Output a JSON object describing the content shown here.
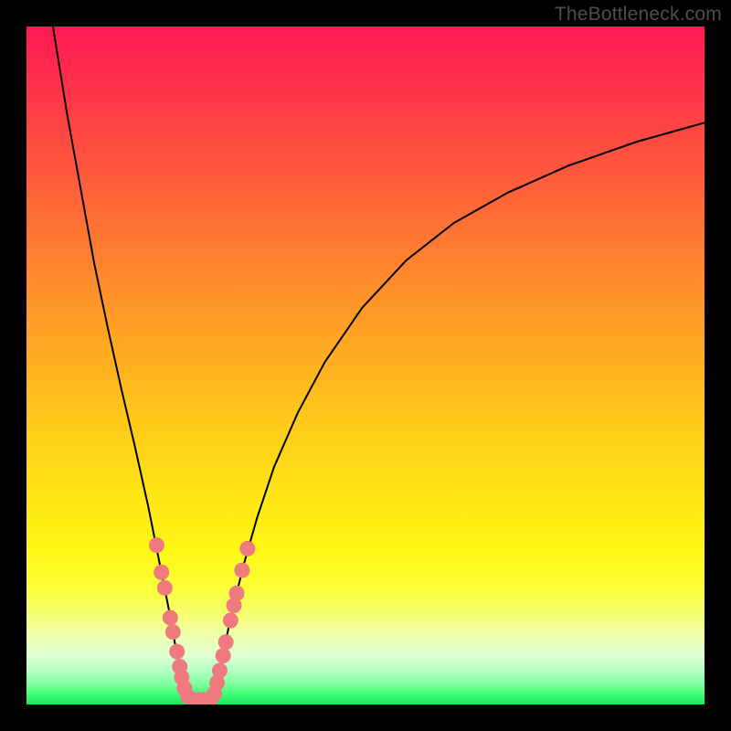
{
  "watermark": "TheBottleneck.com",
  "colors": {
    "frame": "#000000",
    "curve": "#000000",
    "marker_fill": "#ee7a80",
    "marker_stroke": "#c9595f"
  },
  "chart_data": {
    "type": "line",
    "title": "",
    "xlabel": "",
    "ylabel": "",
    "xlim": [
      0,
      100
    ],
    "ylim": [
      0,
      100
    ],
    "grid": false,
    "legend": false,
    "series": [
      {
        "name": "left-curve",
        "x": [
          3.9,
          6.0,
          8.0,
          10.0,
          12.0,
          14.0,
          16.0,
          18.0,
          19.0,
          20.0,
          21.0,
          21.9,
          22.7,
          23.4,
          24.0
        ],
        "y": [
          100.0,
          87.0,
          76.0,
          65.0,
          55.5,
          46.5,
          38.0,
          29.0,
          24.0,
          19.0,
          14.0,
          9.0,
          4.5,
          1.8,
          0.0
        ]
      },
      {
        "name": "right-curve",
        "x": [
          27.5,
          28.3,
          29.3,
          30.4,
          32.0,
          34.0,
          36.5,
          40.0,
          44.0,
          49.5,
          56.0,
          63.0,
          71.0,
          80.0,
          90.0,
          100.0
        ],
        "y": [
          0.0,
          4.0,
          9.0,
          14.0,
          20.5,
          27.5,
          35.0,
          43.0,
          50.5,
          58.5,
          65.5,
          71.0,
          75.5,
          79.5,
          83.0,
          85.8
        ]
      }
    ],
    "markers": {
      "name": "highlighted-points",
      "points": [
        {
          "x": 19.2,
          "y": 23.5
        },
        {
          "x": 19.9,
          "y": 19.5
        },
        {
          "x": 20.4,
          "y": 17.2
        },
        {
          "x": 21.2,
          "y": 12.8
        },
        {
          "x": 21.6,
          "y": 10.7
        },
        {
          "x": 22.2,
          "y": 7.8
        },
        {
          "x": 22.6,
          "y": 5.6
        },
        {
          "x": 22.9,
          "y": 4.0
        },
        {
          "x": 23.3,
          "y": 2.4
        },
        {
          "x": 23.8,
          "y": 1.2
        },
        {
          "x": 24.6,
          "y": 0.7
        },
        {
          "x": 25.5,
          "y": 0.7
        },
        {
          "x": 26.4,
          "y": 0.7
        },
        {
          "x": 27.2,
          "y": 0.9
        },
        {
          "x": 27.7,
          "y": 1.6
        },
        {
          "x": 28.1,
          "y": 3.2
        },
        {
          "x": 28.5,
          "y": 5.0
        },
        {
          "x": 29.0,
          "y": 7.2
        },
        {
          "x": 29.4,
          "y": 9.2
        },
        {
          "x": 30.1,
          "y": 12.4
        },
        {
          "x": 30.6,
          "y": 14.6
        },
        {
          "x": 31.0,
          "y": 16.4
        },
        {
          "x": 31.8,
          "y": 19.8
        },
        {
          "x": 32.6,
          "y": 23.0
        }
      ]
    }
  }
}
